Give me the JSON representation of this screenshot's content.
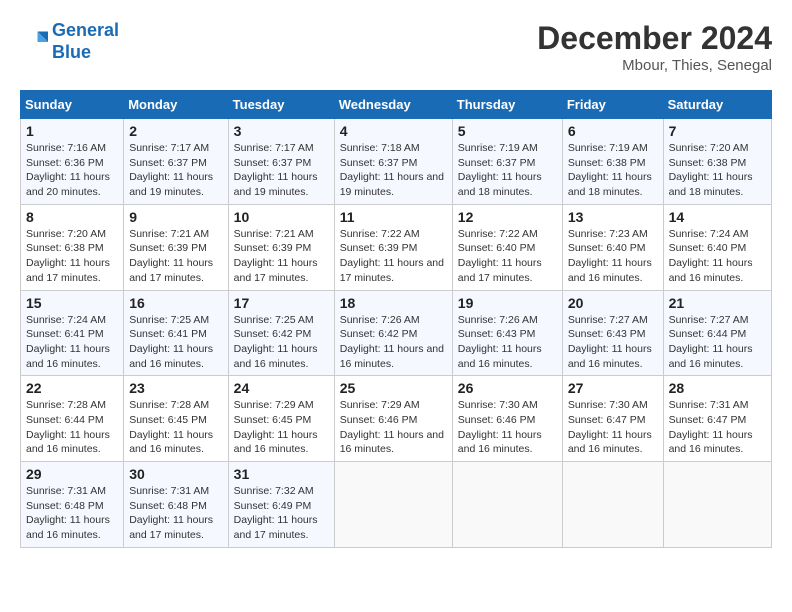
{
  "header": {
    "logo_line1": "General",
    "logo_line2": "Blue",
    "month_year": "December 2024",
    "location": "Mbour, Thies, Senegal"
  },
  "weekdays": [
    "Sunday",
    "Monday",
    "Tuesday",
    "Wednesday",
    "Thursday",
    "Friday",
    "Saturday"
  ],
  "weeks": [
    [
      {
        "day": "1",
        "sunrise": "Sunrise: 7:16 AM",
        "sunset": "Sunset: 6:36 PM",
        "daylight": "Daylight: 11 hours and 20 minutes."
      },
      {
        "day": "2",
        "sunrise": "Sunrise: 7:17 AM",
        "sunset": "Sunset: 6:37 PM",
        "daylight": "Daylight: 11 hours and 19 minutes."
      },
      {
        "day": "3",
        "sunrise": "Sunrise: 7:17 AM",
        "sunset": "Sunset: 6:37 PM",
        "daylight": "Daylight: 11 hours and 19 minutes."
      },
      {
        "day": "4",
        "sunrise": "Sunrise: 7:18 AM",
        "sunset": "Sunset: 6:37 PM",
        "daylight": "Daylight: 11 hours and 19 minutes."
      },
      {
        "day": "5",
        "sunrise": "Sunrise: 7:19 AM",
        "sunset": "Sunset: 6:37 PM",
        "daylight": "Daylight: 11 hours and 18 minutes."
      },
      {
        "day": "6",
        "sunrise": "Sunrise: 7:19 AM",
        "sunset": "Sunset: 6:38 PM",
        "daylight": "Daylight: 11 hours and 18 minutes."
      },
      {
        "day": "7",
        "sunrise": "Sunrise: 7:20 AM",
        "sunset": "Sunset: 6:38 PM",
        "daylight": "Daylight: 11 hours and 18 minutes."
      }
    ],
    [
      {
        "day": "8",
        "sunrise": "Sunrise: 7:20 AM",
        "sunset": "Sunset: 6:38 PM",
        "daylight": "Daylight: 11 hours and 17 minutes."
      },
      {
        "day": "9",
        "sunrise": "Sunrise: 7:21 AM",
        "sunset": "Sunset: 6:39 PM",
        "daylight": "Daylight: 11 hours and 17 minutes."
      },
      {
        "day": "10",
        "sunrise": "Sunrise: 7:21 AM",
        "sunset": "Sunset: 6:39 PM",
        "daylight": "Daylight: 11 hours and 17 minutes."
      },
      {
        "day": "11",
        "sunrise": "Sunrise: 7:22 AM",
        "sunset": "Sunset: 6:39 PM",
        "daylight": "Daylight: 11 hours and 17 minutes."
      },
      {
        "day": "12",
        "sunrise": "Sunrise: 7:22 AM",
        "sunset": "Sunset: 6:40 PM",
        "daylight": "Daylight: 11 hours and 17 minutes."
      },
      {
        "day": "13",
        "sunrise": "Sunrise: 7:23 AM",
        "sunset": "Sunset: 6:40 PM",
        "daylight": "Daylight: 11 hours and 16 minutes."
      },
      {
        "day": "14",
        "sunrise": "Sunrise: 7:24 AM",
        "sunset": "Sunset: 6:40 PM",
        "daylight": "Daylight: 11 hours and 16 minutes."
      }
    ],
    [
      {
        "day": "15",
        "sunrise": "Sunrise: 7:24 AM",
        "sunset": "Sunset: 6:41 PM",
        "daylight": "Daylight: 11 hours and 16 minutes."
      },
      {
        "day": "16",
        "sunrise": "Sunrise: 7:25 AM",
        "sunset": "Sunset: 6:41 PM",
        "daylight": "Daylight: 11 hours and 16 minutes."
      },
      {
        "day": "17",
        "sunrise": "Sunrise: 7:25 AM",
        "sunset": "Sunset: 6:42 PM",
        "daylight": "Daylight: 11 hours and 16 minutes."
      },
      {
        "day": "18",
        "sunrise": "Sunrise: 7:26 AM",
        "sunset": "Sunset: 6:42 PM",
        "daylight": "Daylight: 11 hours and 16 minutes."
      },
      {
        "day": "19",
        "sunrise": "Sunrise: 7:26 AM",
        "sunset": "Sunset: 6:43 PM",
        "daylight": "Daylight: 11 hours and 16 minutes."
      },
      {
        "day": "20",
        "sunrise": "Sunrise: 7:27 AM",
        "sunset": "Sunset: 6:43 PM",
        "daylight": "Daylight: 11 hours and 16 minutes."
      },
      {
        "day": "21",
        "sunrise": "Sunrise: 7:27 AM",
        "sunset": "Sunset: 6:44 PM",
        "daylight": "Daylight: 11 hours and 16 minutes."
      }
    ],
    [
      {
        "day": "22",
        "sunrise": "Sunrise: 7:28 AM",
        "sunset": "Sunset: 6:44 PM",
        "daylight": "Daylight: 11 hours and 16 minutes."
      },
      {
        "day": "23",
        "sunrise": "Sunrise: 7:28 AM",
        "sunset": "Sunset: 6:45 PM",
        "daylight": "Daylight: 11 hours and 16 minutes."
      },
      {
        "day": "24",
        "sunrise": "Sunrise: 7:29 AM",
        "sunset": "Sunset: 6:45 PM",
        "daylight": "Daylight: 11 hours and 16 minutes."
      },
      {
        "day": "25",
        "sunrise": "Sunrise: 7:29 AM",
        "sunset": "Sunset: 6:46 PM",
        "daylight": "Daylight: 11 hours and 16 minutes."
      },
      {
        "day": "26",
        "sunrise": "Sunrise: 7:30 AM",
        "sunset": "Sunset: 6:46 PM",
        "daylight": "Daylight: 11 hours and 16 minutes."
      },
      {
        "day": "27",
        "sunrise": "Sunrise: 7:30 AM",
        "sunset": "Sunset: 6:47 PM",
        "daylight": "Daylight: 11 hours and 16 minutes."
      },
      {
        "day": "28",
        "sunrise": "Sunrise: 7:31 AM",
        "sunset": "Sunset: 6:47 PM",
        "daylight": "Daylight: 11 hours and 16 minutes."
      }
    ],
    [
      {
        "day": "29",
        "sunrise": "Sunrise: 7:31 AM",
        "sunset": "Sunset: 6:48 PM",
        "daylight": "Daylight: 11 hours and 16 minutes."
      },
      {
        "day": "30",
        "sunrise": "Sunrise: 7:31 AM",
        "sunset": "Sunset: 6:48 PM",
        "daylight": "Daylight: 11 hours and 17 minutes."
      },
      {
        "day": "31",
        "sunrise": "Sunrise: 7:32 AM",
        "sunset": "Sunset: 6:49 PM",
        "daylight": "Daylight: 11 hours and 17 minutes."
      },
      null,
      null,
      null,
      null
    ]
  ]
}
